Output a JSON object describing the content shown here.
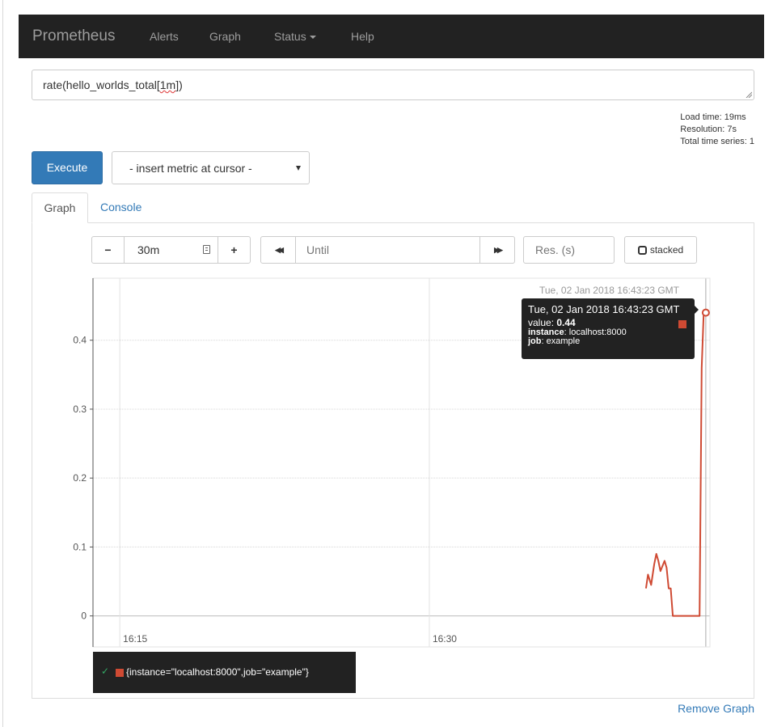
{
  "navbar": {
    "brand": "Prometheus",
    "links": [
      "Alerts",
      "Graph",
      "Status",
      "Help"
    ]
  },
  "expression": {
    "prefix": "rate(hello_worlds_total[",
    "underlined": "1m",
    "suffix": "])"
  },
  "stats": {
    "load_time": "Load time: 19ms",
    "resolution": "Resolution: 7s",
    "total_series": "Total time series: 1"
  },
  "execute_label": "Execute",
  "metric_select": "- insert metric at cursor -",
  "tabs": [
    "Graph",
    "Console"
  ],
  "controls": {
    "minus": "−",
    "range": "30m",
    "plus": "+",
    "back": "◀◀",
    "until_placeholder": "Until",
    "forward": "▶▶",
    "res_placeholder": "Res. (s)",
    "stacked_label": "stacked"
  },
  "hover": {
    "timestamp": "Tue, 02 Jan 2018 16:43:23 GMT",
    "tooltip_date": "Tue, 02 Jan 2018 16:43:23 GMT",
    "value_key": "value",
    "value": "0.44",
    "instance_key": "instance",
    "instance": "localhost:8000",
    "job_key": "job",
    "job": "example"
  },
  "chart_data": {
    "type": "line",
    "title": "",
    "xlabel": "",
    "ylabel": "",
    "x_ticks": [
      "16:15",
      "16:30"
    ],
    "y_ticks": [
      0,
      0.1,
      0.2,
      0.3,
      0.4
    ],
    "ylim": [
      -0.045,
      0.49
    ],
    "xlim_minutes": [
      13.7,
      43.6
    ],
    "grid": true,
    "series": [
      {
        "name": "{instance=\"localhost:8000\",job=\"example\"}",
        "color": "#cf4a33",
        "x_minutes": [
          40.5,
          40.6,
          40.75,
          40.9,
          41.0,
          41.1,
          41.2,
          41.4,
          41.5,
          41.6,
          41.7,
          41.8,
          43.1,
          43.2,
          43.3,
          43.4
        ],
        "values": [
          0.04,
          0.06,
          0.045,
          0.075,
          0.09,
          0.08,
          0.065,
          0.08,
          0.07,
          0.04,
          0.04,
          0,
          0,
          0.36,
          0.44,
          0.44
        ]
      }
    ]
  },
  "legend_label": "{instance=\"localhost:8000\",job=\"example\"}",
  "remove_graph": "Remove Graph"
}
